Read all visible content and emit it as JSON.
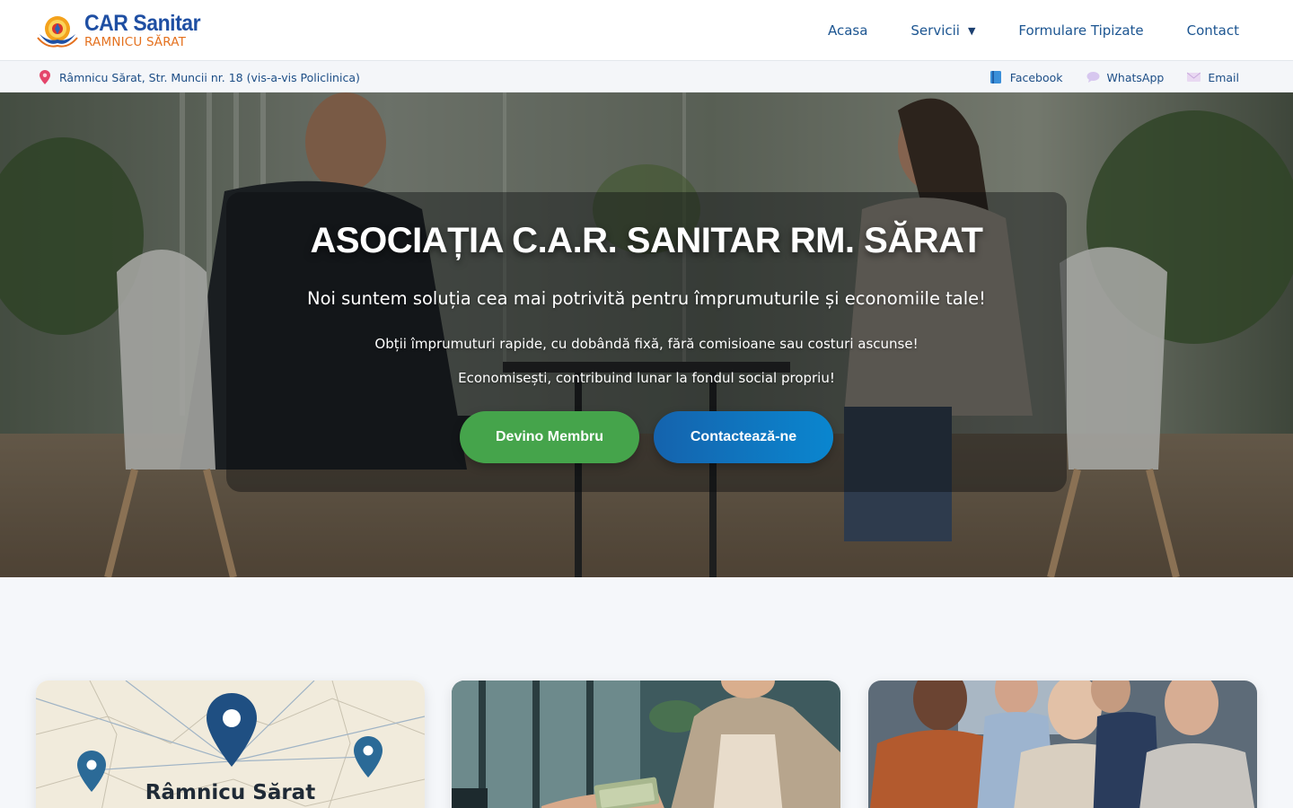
{
  "brand": {
    "title": "CAR Sanitar",
    "subtitle": "RAMNICU SĂRAT"
  },
  "nav": {
    "items": [
      {
        "label": "Acasa"
      },
      {
        "label": "Servicii",
        "has_dropdown": true
      },
      {
        "label": "Formulare Tipizate"
      },
      {
        "label": "Contact"
      }
    ]
  },
  "infobar": {
    "address": "Râmnicu Sărat, Str. Muncii nr. 18 (vis-a-vis Policlinica)",
    "socials": [
      {
        "label": "Facebook",
        "icon": "facebook-icon"
      },
      {
        "label": "WhatsApp",
        "icon": "whatsapp-icon"
      },
      {
        "label": "Email",
        "icon": "email-icon"
      }
    ]
  },
  "hero": {
    "title": "ASOCIAȚIA C.A.R. SANITAR RM. SĂRAT",
    "subtitle": "Noi suntem soluția cea mai potrivită pentru împrumuturile și economiile tale!",
    "line1": "Obții împrumuturi rapide, cu dobândă fixă, fără comisioane sau costuri ascunse!",
    "line2": "Economisești, contribuind lunar la fondul social propriu!",
    "primary_button": "Devino Membru",
    "secondary_button": "Contactează-ne"
  },
  "cards": [
    {
      "image": "map-image",
      "label": "Râmnicu Sărat"
    },
    {
      "image": "money-handover-image"
    },
    {
      "image": "members-group-image"
    }
  ],
  "colors": {
    "brand_blue": "#1f4fa3",
    "brand_orange": "#e4711f",
    "nav_text": "#1c5591",
    "button_green": "#45a44b",
    "button_blue": "#1563ad"
  }
}
